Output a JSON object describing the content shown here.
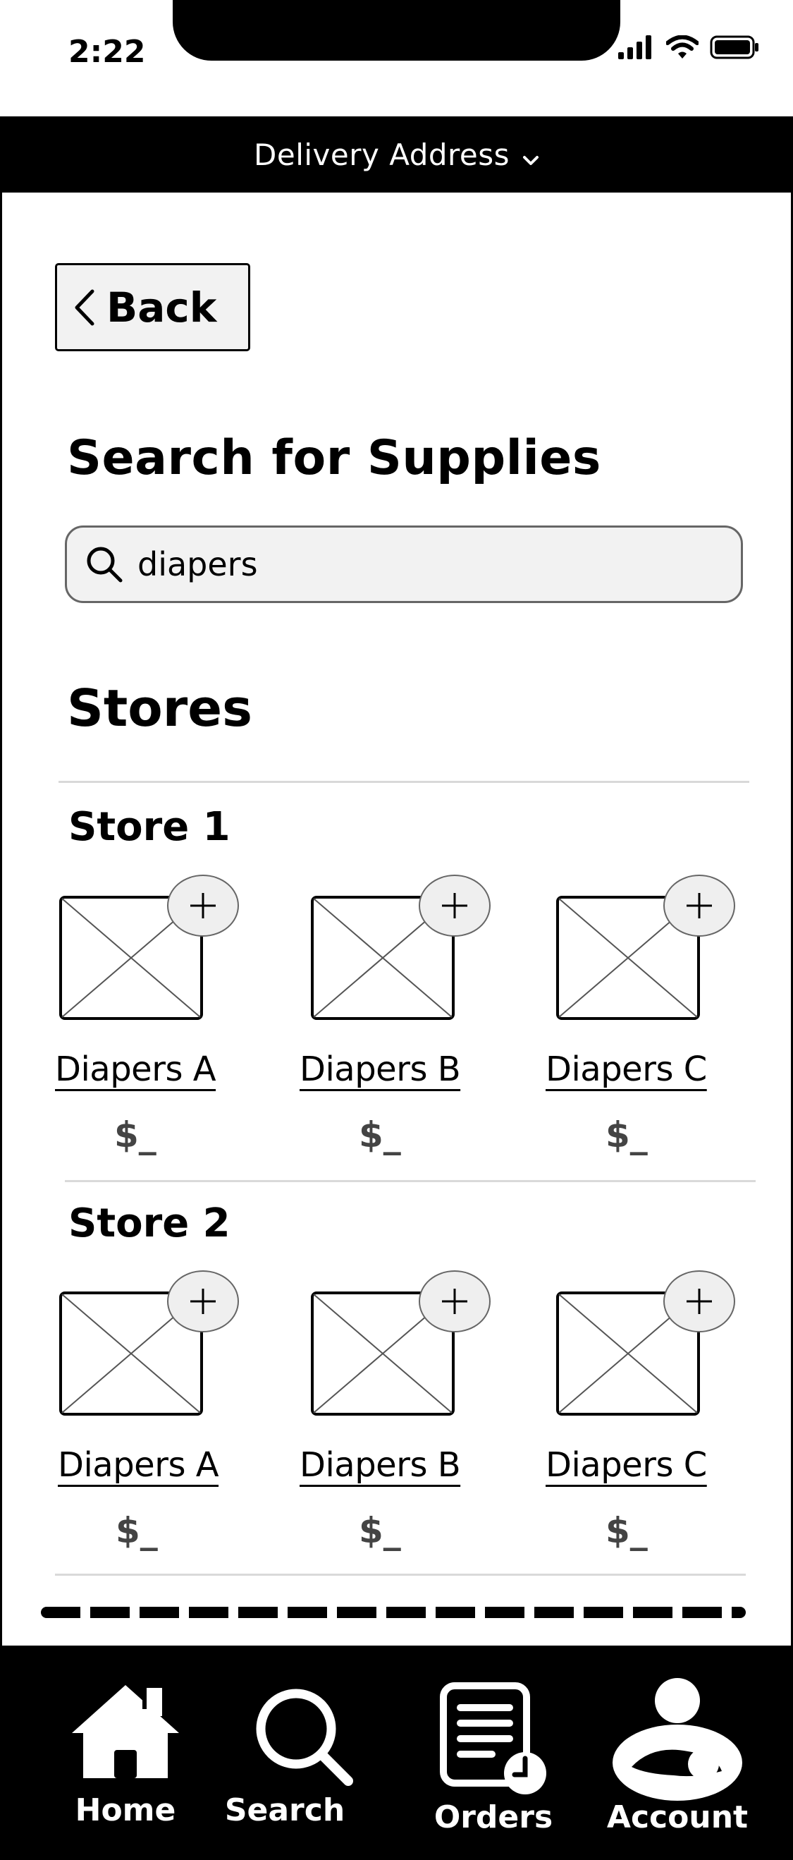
{
  "status_bar": {
    "time": "2:22"
  },
  "header": {
    "delivery_label": "Delivery Address"
  },
  "back": {
    "label": "Back"
  },
  "search": {
    "title": "Search for Supplies",
    "query": "diapers"
  },
  "stores_section": {
    "title": "Stores"
  },
  "stores": [
    {
      "name": "Store 1",
      "products": [
        {
          "name": "Diapers A",
          "price": "$_"
        },
        {
          "name": "Diapers B",
          "price": "$_"
        },
        {
          "name": "Diapers C",
          "price": "$_"
        }
      ]
    },
    {
      "name": "Store 2",
      "products": [
        {
          "name": "Diapers A",
          "price": "$_"
        },
        {
          "name": "Diapers B",
          "price": "$_"
        },
        {
          "name": "Diapers C",
          "price": "$_"
        }
      ]
    }
  ],
  "nav": {
    "items": [
      {
        "label": "Home",
        "icon": "home-icon"
      },
      {
        "label": "Search",
        "icon": "search-icon"
      },
      {
        "label": "Orders",
        "icon": "orders-icon"
      },
      {
        "label": "Account",
        "icon": "account-icon"
      }
    ]
  },
  "colors": {
    "bar": "#000000",
    "background": "#ffffff",
    "field": "#f2f2f2"
  }
}
